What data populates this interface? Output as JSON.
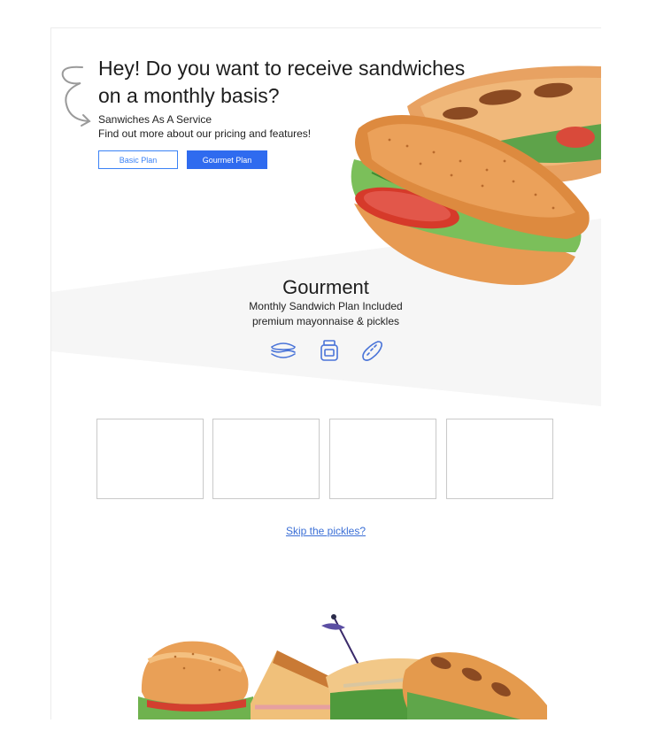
{
  "hero": {
    "title": "Hey! Do you want to receive sandwiches on a monthly basis?",
    "subtitle": "Sanwiches As A Service",
    "description": "Find out more about our pricing and features!"
  },
  "plans": {
    "basic_label": "Basic Plan",
    "gourmet_label": "Gourmet Plan"
  },
  "featured_plan": {
    "name": "Gourment",
    "description_line1": "Monthly Sandwich Plan Included",
    "description_line2": "premium mayonnaise & pickles",
    "icons": [
      "sandwich-icon",
      "jar-icon",
      "pickle-icon"
    ]
  },
  "cards": [
    {},
    {},
    {},
    {}
  ],
  "skip_link": "Skip the pickles?",
  "colors": {
    "accent": "#2f6bef",
    "outline": "#3b82f6",
    "band": "#f6f6f6",
    "icon": "#4a74d8"
  }
}
